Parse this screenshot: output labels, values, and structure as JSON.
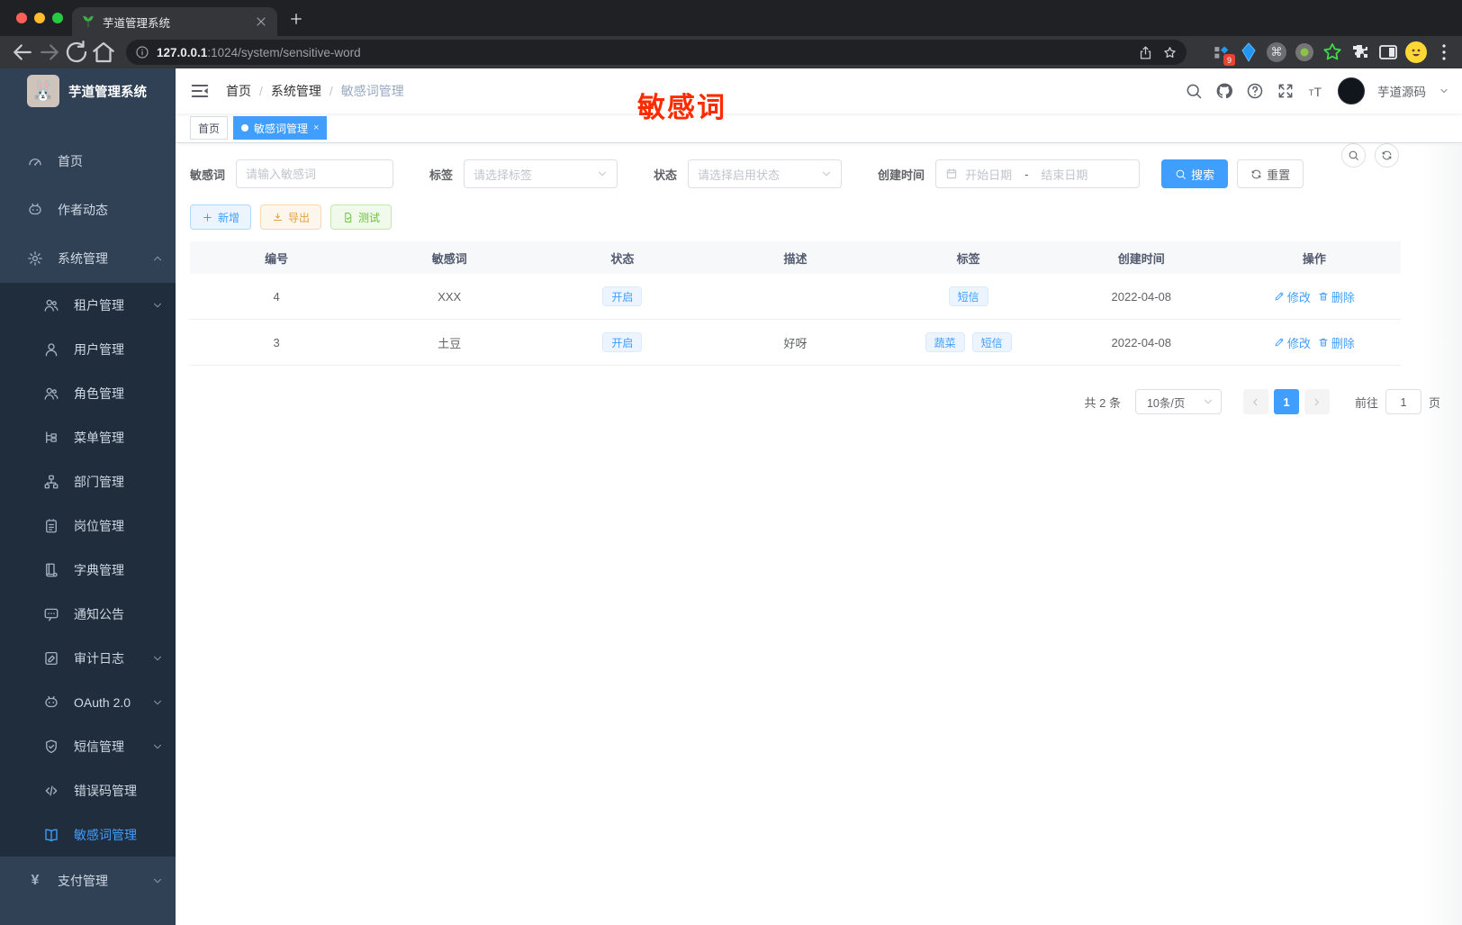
{
  "browser": {
    "tab_title": "芋道管理系统",
    "url_host": "127.0.0.1",
    "url_rest": ":1024/system/sensitive-word",
    "ext_badge": "9"
  },
  "sidebar": {
    "title": "芋道管理系统",
    "items": [
      {
        "icon": "gauge",
        "label": "首页",
        "sub": false,
        "chevron": ""
      },
      {
        "icon": "chatface",
        "label": "作者动态",
        "sub": false,
        "chevron": ""
      },
      {
        "icon": "gear",
        "label": "系统管理",
        "sub": false,
        "chevron": "up"
      },
      {
        "icon": "users",
        "label": "租户管理",
        "sub": true,
        "chevron": "down"
      },
      {
        "icon": "user",
        "label": "用户管理",
        "sub": true,
        "chevron": ""
      },
      {
        "icon": "users",
        "label": "角色管理",
        "sub": true,
        "chevron": ""
      },
      {
        "icon": "tree",
        "label": "菜单管理",
        "sub": true,
        "chevron": ""
      },
      {
        "icon": "org",
        "label": "部门管理",
        "sub": true,
        "chevron": ""
      },
      {
        "icon": "idbadge",
        "label": "岗位管理",
        "sub": true,
        "chevron": ""
      },
      {
        "icon": "books",
        "label": "字典管理",
        "sub": true,
        "chevron": ""
      },
      {
        "icon": "comment",
        "label": "通知公告",
        "sub": true,
        "chevron": ""
      },
      {
        "icon": "log",
        "label": "审计日志",
        "sub": true,
        "chevron": "down"
      },
      {
        "icon": "chatface",
        "label": "OAuth 2.0",
        "sub": true,
        "chevron": "down"
      },
      {
        "icon": "shield",
        "label": "短信管理",
        "sub": true,
        "chevron": "down"
      },
      {
        "icon": "code",
        "label": "错误码管理",
        "sub": true,
        "chevron": ""
      },
      {
        "icon": "bookopen",
        "label": "敏感词管理",
        "sub": true,
        "chevron": "",
        "active": true
      },
      {
        "icon": "yen",
        "label": "支付管理",
        "sub": false,
        "chevron": "down"
      }
    ]
  },
  "header": {
    "breadcrumb": [
      "首页",
      "系统管理",
      "敏感词管理"
    ],
    "user_name": "芋道源码",
    "annotation": "敏感词"
  },
  "tags_view": [
    {
      "label": "首页",
      "active": false
    },
    {
      "label": "敏感词管理",
      "active": true,
      "closable": true
    }
  ],
  "filters": {
    "keyword_label": "敏感词",
    "keyword_placeholder": "请输入敏感词",
    "tag_label": "标签",
    "tag_placeholder": "请选择标签",
    "status_label": "状态",
    "status_placeholder": "请选择启用状态",
    "date_label": "创建时间",
    "date_start": "开始日期",
    "date_separator": "-",
    "date_end": "结束日期",
    "search_label": "搜索",
    "reset_label": "重置"
  },
  "actions": {
    "add_label": "新增",
    "export_label": "导出",
    "test_label": "测试"
  },
  "table": {
    "columns": [
      "编号",
      "敏感词",
      "状态",
      "描述",
      "标签",
      "创建时间",
      "操作"
    ],
    "rows": [
      {
        "id": "4",
        "word": "XXX",
        "status": "开启",
        "desc": "",
        "tags": [
          "短信"
        ],
        "created": "2022-04-08"
      },
      {
        "id": "3",
        "word": "土豆",
        "status": "开启",
        "desc": "好呀",
        "tags": [
          "蔬菜",
          "短信"
        ],
        "created": "2022-04-08"
      }
    ],
    "edit_label": "修改",
    "delete_label": "删除"
  },
  "pagination": {
    "total_text": "共 2 条",
    "page_size": "10条/页",
    "current_page": "1",
    "goto_label": "前往",
    "goto_value": "1",
    "page_unit": "页"
  },
  "colors": {
    "accent": "#409eff",
    "sidebar_bg": "#304156",
    "submenu_bg": "#1f2d3d",
    "annotation_red": "#fe2b00",
    "warning": "#e6a23c",
    "success": "#67c23a"
  }
}
